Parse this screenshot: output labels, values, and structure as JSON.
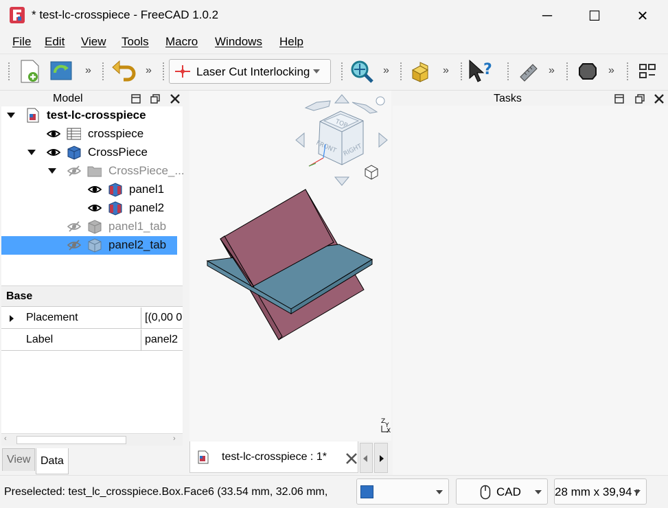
{
  "window": {
    "title": "* test-lc-crosspiece - FreeCAD 1.0.2",
    "minimize": "─",
    "maximize": "☐",
    "close": "✕"
  },
  "menu": [
    "File",
    "Edit",
    "View",
    "Tools",
    "Macro",
    "Windows",
    "Help"
  ],
  "toolbar": {
    "overflow": "»",
    "workbench": "Laser Cut Interlocking"
  },
  "model_panel": {
    "title": "Model",
    "tree": [
      {
        "label": "test-lc-crosspiece",
        "bold": true
      },
      {
        "label": "crosspiece"
      },
      {
        "label": "CrossPiece"
      },
      {
        "label": "CrossPiece_..."
      },
      {
        "label": "panel1"
      },
      {
        "label": "panel2"
      },
      {
        "label": "panel1_tab"
      },
      {
        "label": "panel2_tab"
      }
    ]
  },
  "properties": {
    "group": "Base",
    "rows": [
      {
        "name": "Placement",
        "value": "[(0,00 0"
      },
      {
        "name": "Label",
        "value": "panel2"
      }
    ],
    "tabs": [
      "View",
      "Data"
    ]
  },
  "viewport": {
    "doc_tab": "test-lc-crosspiece : 1*",
    "navcube": {
      "top": "TOP",
      "front": "FRONT",
      "right": "RIGHT"
    },
    "axis_z": "Z",
    "axis_y": "Y",
    "axis_x": "X"
  },
  "tasks": {
    "title": "Tasks"
  },
  "status": {
    "text": "Preselected: test_lc_crosspiece.Box.Face6 (33.54 mm, 32.06 mm,",
    "nav_style": "CAD",
    "dimensions": "28 mm x 39,94 r"
  },
  "colors": {
    "selection": "#4da3ff",
    "panel_blue": "#5e8aa0",
    "panel_red": "#9a5f72"
  }
}
